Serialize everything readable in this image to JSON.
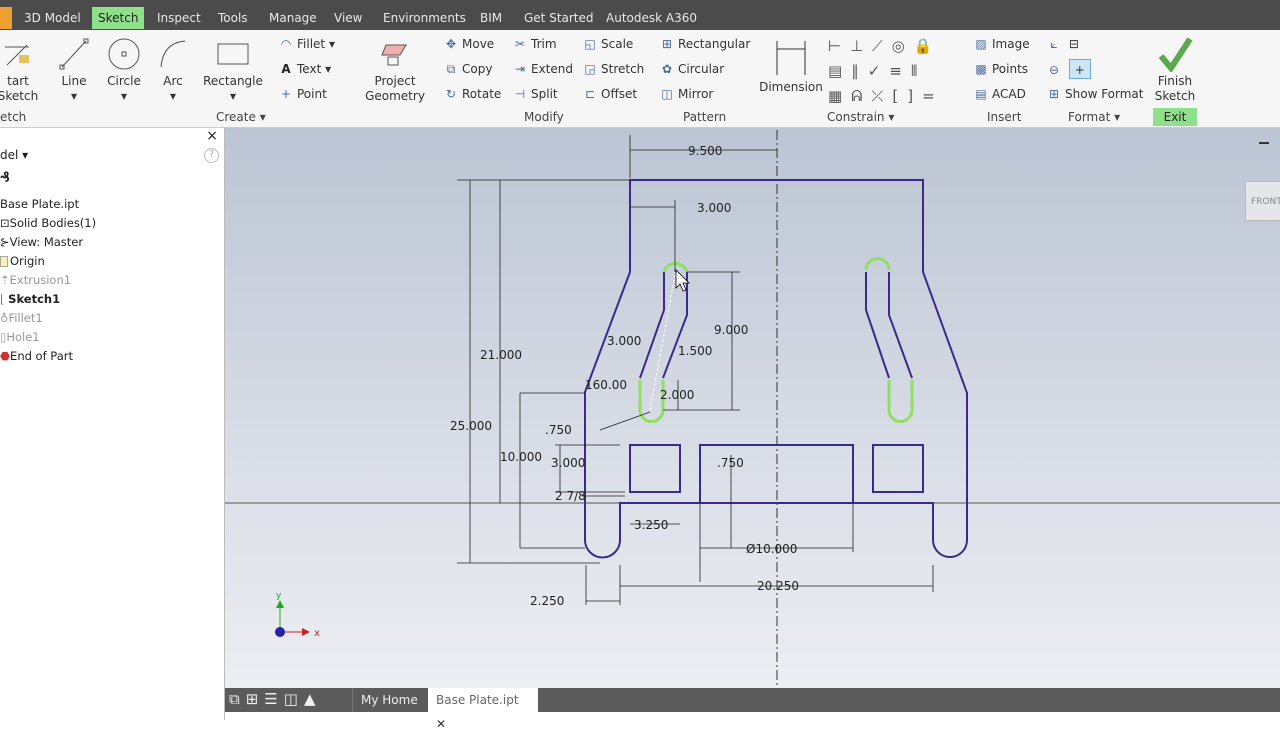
{
  "ribbon_tabs": [
    "3D Model",
    "Sketch",
    "Inspect",
    "Tools",
    "Manage",
    "View",
    "Environments",
    "BIM",
    "Get Started",
    "Autodesk A360"
  ],
  "active_tab": "Sketch",
  "ribbon": {
    "start_sketch": "tart\nSketch",
    "line": "Line",
    "circle": "Circle",
    "arc": "Arc",
    "rectangle": "Rectangle",
    "fillet": "Fillet",
    "text": "Text",
    "point": "Point",
    "project_geometry": "Project\nGeometry",
    "move": "Move",
    "copy": "Copy",
    "rotate": "Rotate",
    "trim": "Trim",
    "extend": "Extend",
    "split": "Split",
    "scale": "Scale",
    "stretch": "Stretch",
    "offset": "Offset",
    "rect_pattern": "Rectangular",
    "circular": "Circular",
    "mirror": "Mirror",
    "dimension": "Dimension",
    "image": "Image",
    "points": "Points",
    "acad": "ACAD",
    "show_format": "Show Format",
    "finish_sketch": "Finish\nSketch",
    "panels": {
      "sketch": "etch",
      "create": "Create ▾",
      "modify": "Modify",
      "pattern": "Pattern",
      "constrain": "Constrain ▾",
      "insert": "Insert",
      "format": "Format ▾",
      "exit": "Exit"
    }
  },
  "browser": {
    "title": "del ▾",
    "help": "?",
    "close": "×",
    "items": [
      {
        "label": "Base Plate.ipt",
        "state": "normal"
      },
      {
        "label": "Solid Bodies(1)",
        "state": "normal"
      },
      {
        "label": "View: Master",
        "state": "normal"
      },
      {
        "label": "Origin",
        "state": "normal"
      },
      {
        "label": "Extrusion1",
        "state": "dimmed"
      },
      {
        "label": "Sketch1",
        "state": "bold"
      },
      {
        "label": "Fillet1",
        "state": "dimmed"
      },
      {
        "label": "Hole1",
        "state": "dimmed"
      },
      {
        "label": "End of Part",
        "state": "normal"
      }
    ]
  },
  "viewport": {
    "viewcube": "FRONT",
    "axis_x": "x",
    "axis_y": "y",
    "dimensions": {
      "d9500": "9.500",
      "d3000a": "3.000",
      "d9000": "9.000",
      "d3000b": "3.000",
      "d1500": "1.500",
      "d21000": "21.000",
      "d160": "160.00",
      "d2000": "2.000",
      "d25000": "25.000",
      "d750a": ".750",
      "d10000": "10.000",
      "d3000c": "3.000",
      "d750b": ".750",
      "d278": "2 7/8",
      "d3250": "3.250",
      "d10dia": "Ø10.000",
      "d20250": "20.250",
      "d2250": "2.250"
    },
    "colors": {
      "geometry": "#3a2a8a",
      "selected": "#8fe060"
    }
  },
  "document_tabs": {
    "home": "My Home",
    "active": "Base Plate.ipt",
    "close": "✕"
  }
}
